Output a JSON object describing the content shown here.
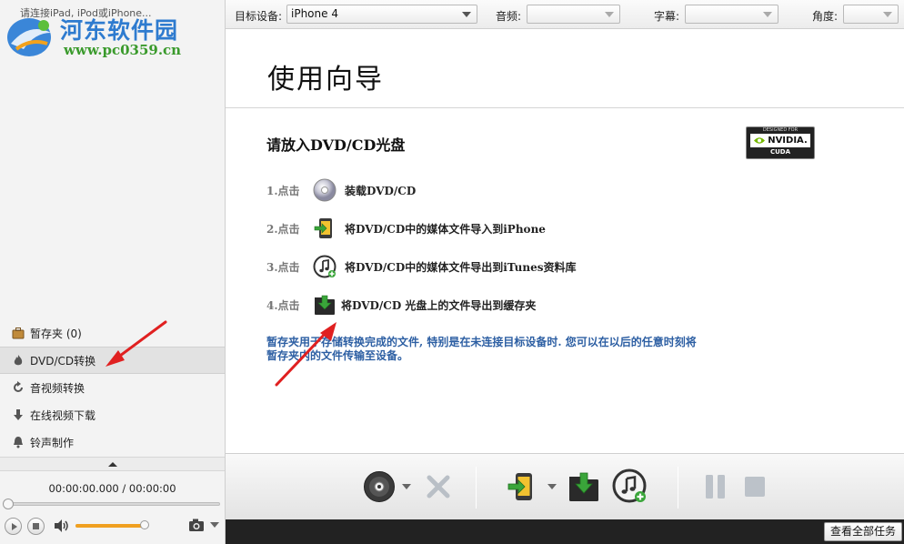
{
  "connect_hint": "请连接iPad, iPod或iPhone...",
  "watermark": {
    "title": "河东软件园",
    "url": "www.pc0359.cn"
  },
  "sidebar": {
    "items": [
      {
        "label": "暂存夹 (0)",
        "icon": "briefcase-icon"
      },
      {
        "label": "DVD/CD转换",
        "icon": "fire-icon",
        "active": true
      },
      {
        "label": "音视频转换",
        "icon": "convert-icon"
      },
      {
        "label": "在线视频下载",
        "icon": "download-arrow-icon"
      },
      {
        "label": "铃声制作",
        "icon": "bell-icon"
      }
    ]
  },
  "player": {
    "time": "00:00:00.000 / 00:00:00",
    "seek": 0,
    "volume": 0.95
  },
  "topbar": {
    "device_label": "目标设备:",
    "device_value": "iPhone 4",
    "audio_label": "音频:",
    "audio_value": "",
    "subtitle_label": "字幕:",
    "subtitle_value": "",
    "angle_label": "角度:",
    "angle_value": ""
  },
  "wizard": {
    "title": "使用向导",
    "insert_title": "请放入DVD/CD光盘",
    "badge": {
      "top": "DESIGNED FOR",
      "brand": "NVIDIA.",
      "bottom": "CUDA"
    },
    "steps": [
      {
        "num": "1.点击",
        "text": "装载DVD/CD",
        "icon": "disc-icon"
      },
      {
        "num": "2.点击",
        "text": "将DVD/CD中的媒体文件导入到iPhone",
        "icon": "import-to-device-icon"
      },
      {
        "num": "3.点击",
        "text": "将DVD/CD中的媒体文件导出到iTunes资料库",
        "icon": "itunes-icon"
      },
      {
        "num": "4.点击",
        "text": "将DVD/CD 光盘上的文件导出到缓存夹",
        "icon": "export-folder-icon"
      }
    ],
    "note_line1": "暂存夹用于存储转换完成的文件, 特别是在未连接目标设备时. 您可以在以后的任意时刻将",
    "note_line2": "暂存夹内的文件传输至设备。"
  },
  "statusbar": {
    "view_all_label": "查看全部任务"
  },
  "colors": {
    "accent_blue": "#2d5fa3",
    "volume_orange": "#f0a020",
    "annotation_red": "#e02020"
  }
}
